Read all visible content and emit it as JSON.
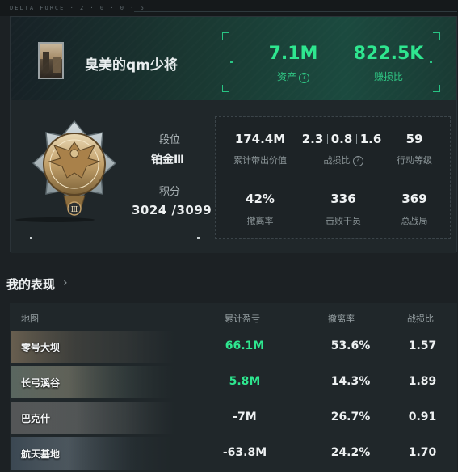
{
  "brand": "DELTA FORCE · 2 · 0 · 0 · 5",
  "profile": {
    "username": "臭美的qm少将",
    "assets_value": "7.1M",
    "assets_label": "资产",
    "assets_help": "?",
    "profit_value": "822.5K",
    "profit_label": "赚损比"
  },
  "rank": {
    "tier_label": "段位",
    "tier": "铂金Ⅲ",
    "points_label": "积分",
    "points": "3024 /3099",
    "emblem_numeral": "Ⅲ"
  },
  "stats": {
    "carried_value": "174.4M",
    "carried_label": "累计带出价值",
    "kd_1": "2.3",
    "kd_2": "0.8",
    "kd_3": "1.6",
    "kd_label": "战损比",
    "kd_help": "?",
    "action_level": "59",
    "action_label": "行动等级",
    "evac_rate": "42%",
    "evac_label": "撤离率",
    "kills": "336",
    "kills_label": "击败干员",
    "total_matches": "369",
    "total_label": "总战局"
  },
  "performance": {
    "title": "我的表现",
    "chevron": "›",
    "headers": {
      "map": "地图",
      "profit": "累计盈亏",
      "evac": "撤离率",
      "kd": "战损比"
    },
    "rows": [
      {
        "map": "零号大坝",
        "profit": "66.1M",
        "evac": "53.6%",
        "kd": "1.57",
        "profit_positive": true
      },
      {
        "map": "长弓溪谷",
        "profit": "5.8M",
        "evac": "14.3%",
        "kd": "1.89",
        "profit_positive": true
      },
      {
        "map": "巴克什",
        "profit": "-7M",
        "evac": "26.7%",
        "kd": "0.91",
        "profit_positive": false
      },
      {
        "map": "航天基地",
        "profit": "-63.8M",
        "evac": "24.2%",
        "kd": "1.70",
        "profit_positive": false
      }
    ]
  },
  "colors": {
    "accent_green": "#2ee68f",
    "banner_green": "#1b4a3f",
    "background": "#1c2124"
  }
}
